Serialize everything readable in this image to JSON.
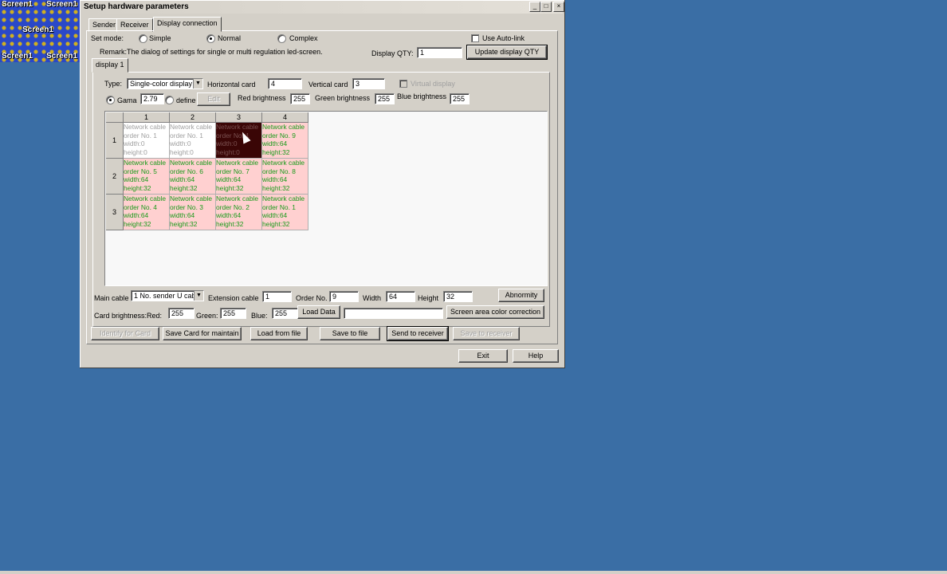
{
  "preview": {
    "labels": [
      "Screen1",
      "Screen1",
      "Screen1",
      "Screen1",
      "Screen1"
    ]
  },
  "window": {
    "title": "Setup hardware parameters",
    "min": "_",
    "max": "□",
    "close": "×"
  },
  "tabs": [
    "Sender",
    "Receiver",
    "Display connection"
  ],
  "set_mode": {
    "label": "Set mode:",
    "options": [
      "Simple",
      "Normal",
      "Complex"
    ],
    "selected": "Normal"
  },
  "auto_link": {
    "label": "Use Auto-link",
    "checked": false
  },
  "remark": "Remark:The dialog of settings for single or multi  regulation led-screen.",
  "display_qty": {
    "label": "Display QTY:",
    "value": "1",
    "button": "Update display QTY"
  },
  "display_tab": "display 1",
  "type": {
    "label": "Type:",
    "value": "Single-color display"
  },
  "horizontal_card": {
    "label": "Horizontal card",
    "value": "4"
  },
  "vertical_card": {
    "label": "Vertical card",
    "value": "3"
  },
  "virtual_display": {
    "label": "Virtual display",
    "checked": false
  },
  "gama": {
    "label": "Gama",
    "value": "2.79"
  },
  "define": {
    "label": "define",
    "edit": "Edit"
  },
  "red_brightness": {
    "label": "Red brightness",
    "value": "255"
  },
  "green_brightness": {
    "label": "Green brightness",
    "value": "255"
  },
  "blue_brightness": {
    "label": "Blue brightness",
    "value": "255"
  },
  "grid": {
    "col_headers": [
      "1",
      "2",
      "3",
      "4"
    ],
    "row_headers": [
      "1",
      "2",
      "3"
    ],
    "rows": [
      [
        {
          "state": "empty",
          "lines": [
            "Network cable",
            "order No. 1",
            "width:0",
            "height:0"
          ]
        },
        {
          "state": "empty",
          "lines": [
            "Network cable",
            "order No. 1",
            "width:0",
            "height:0"
          ]
        },
        {
          "state": "sel",
          "lines": [
            "Network cable",
            "order No. 1",
            "width:0",
            "height:0"
          ]
        },
        {
          "state": "active",
          "lines": [
            "Network cable",
            "order No. 9",
            "width:64",
            "height:32"
          ]
        }
      ],
      [
        {
          "state": "active",
          "lines": [
            "Network cable",
            "order No. 5",
            "width:64",
            "height:32"
          ]
        },
        {
          "state": "active",
          "lines": [
            "Network cable",
            "order No. 6",
            "width:64",
            "height:32"
          ]
        },
        {
          "state": "active",
          "lines": [
            "Network cable",
            "order No. 7",
            "width:64",
            "height:32"
          ]
        },
        {
          "state": "active",
          "lines": [
            "Network cable",
            "order No. 8",
            "width:64",
            "height:32"
          ]
        }
      ],
      [
        {
          "state": "active",
          "lines": [
            "Network cable",
            "order No. 4",
            "width:64",
            "height:32"
          ]
        },
        {
          "state": "active",
          "lines": [
            "Network cable",
            "order No. 3",
            "width:64",
            "height:32"
          ]
        },
        {
          "state": "active",
          "lines": [
            "Network cable",
            "order No. 2",
            "width:64",
            "height:32"
          ]
        },
        {
          "state": "active",
          "lines": [
            "Network cable",
            "order No. 1",
            "width:64",
            "height:32"
          ]
        }
      ]
    ]
  },
  "main_cable": {
    "label": "Main cable",
    "value": "1 No. sender U cab"
  },
  "extension_cable": {
    "label": "Extension cable",
    "value": "1"
  },
  "order_no": {
    "label": "Order No.",
    "value": "9"
  },
  "width": {
    "label": "Width",
    "value": "64"
  },
  "height": {
    "label": "Height",
    "value": "32"
  },
  "abnormity": "Abnormity",
  "card_brightness": {
    "label": "Card brightness:Red:",
    "red": "255",
    "green_label": "Green:",
    "green": "255",
    "blue_label": "Blue:",
    "blue": "255"
  },
  "load_data": "Load Data",
  "load_data_path": "",
  "screen_area_color": "Screen area color correction",
  "actions": {
    "identify": "Identify for Card",
    "save_card": "Save Card for maintain",
    "load_file": "Load from file",
    "save_file": "Save to file",
    "send_receiver": "Send to receiver",
    "save_receiver": "Save to receiver"
  },
  "exit": "Exit",
  "help": "Help"
}
